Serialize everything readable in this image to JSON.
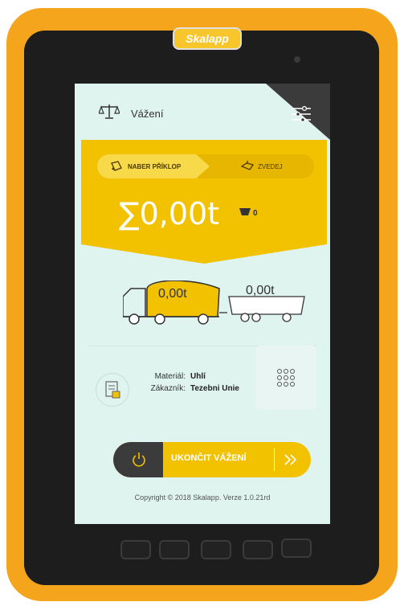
{
  "device": {
    "brand": "Skalapp"
  },
  "header": {
    "title": "Vážení"
  },
  "steps": {
    "step1_label": "NABER PŘÍKLOP",
    "step2_label": "ZVEDEJ"
  },
  "summary": {
    "total": "0,00t",
    "bucket_count": "0"
  },
  "trucks": {
    "truck_value": "0,00t",
    "trailer_value": "0,00t"
  },
  "info": {
    "material_label": "Materiál:",
    "material_value": "Uhlí",
    "customer_label": "Zákazník:",
    "customer_value": "Tezebni Unie"
  },
  "actions": {
    "finish_label": "UKONČIT VÁŽENÍ"
  },
  "footer": {
    "copyright": "Copyright © 2018 Skalapp. Verze 1.0.21rd"
  },
  "colors": {
    "accent": "#f2c200",
    "dark": "#3b3b3b",
    "screen_bg": "#dff3ef",
    "tablet_body": "#f4a51c"
  }
}
